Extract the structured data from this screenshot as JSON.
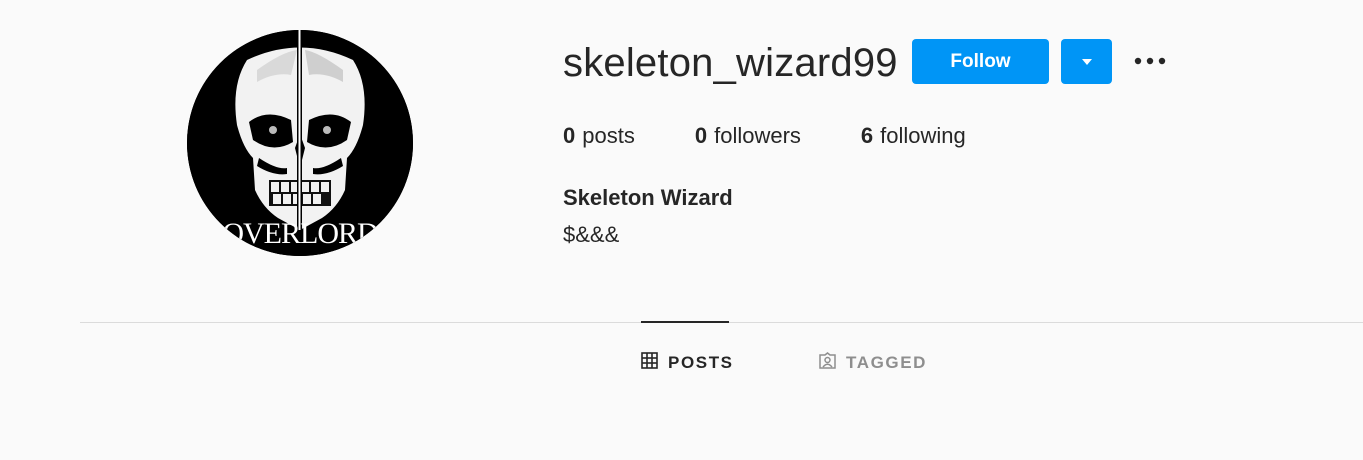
{
  "profile": {
    "username": "skeleton_wizard99",
    "full_name": "Skeleton Wizard",
    "bio": "$&&&",
    "avatar_text": "OVERLORD"
  },
  "actions": {
    "follow_label": "Follow",
    "dropdown_icon": "chevron-down-icon",
    "more_icon": "more-options-icon"
  },
  "stats": {
    "posts": {
      "value": "0",
      "label": "posts"
    },
    "followers": {
      "value": "0",
      "label": "followers"
    },
    "following": {
      "value": "6",
      "label": "following"
    }
  },
  "tabs": [
    {
      "label": "POSTS",
      "icon": "grid-icon",
      "active": true
    },
    {
      "label": "TAGGED",
      "icon": "tagged-icon",
      "active": false
    }
  ],
  "colors": {
    "accent": "#0095f6",
    "background": "#fafafa",
    "text": "#262626",
    "muted": "#8e8e8e",
    "divider": "#dbdbdb"
  }
}
